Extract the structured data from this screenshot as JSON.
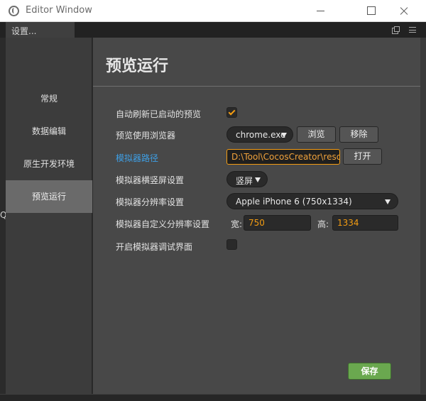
{
  "window": {
    "title": "Editor Window"
  },
  "panel": {
    "tab_label": "设置..."
  },
  "background": {
    "left_mark": "Q"
  },
  "sidebar": {
    "items": [
      {
        "label": "常规",
        "active": false
      },
      {
        "label": "数据编辑",
        "active": false
      },
      {
        "label": "原生开发环境",
        "active": false
      },
      {
        "label": "预览运行",
        "active": true
      }
    ]
  },
  "main": {
    "title": "预览运行",
    "auto_refresh": {
      "label": "自动刷新已启动的预览",
      "checked": true
    },
    "browser": {
      "label": "预览使用浏览器",
      "value": "chrome.exe",
      "browse_label": "浏览",
      "remove_label": "移除"
    },
    "simulator_path": {
      "label": "模拟器路径",
      "value": "D:\\Tool\\CocosCreator\\resou",
      "open_label": "打开"
    },
    "orientation": {
      "label": "模拟器横竖屏设置",
      "value": "竖屏"
    },
    "resolution": {
      "label": "模拟器分辨率设置",
      "value": "Apple iPhone 6 (750x1334)"
    },
    "custom_resolution": {
      "label": "模拟器自定义分辨率设置",
      "width_label": "宽:",
      "width_value": "750",
      "height_label": "高:",
      "height_value": "1334"
    },
    "debug_ui": {
      "label": "开启模拟器调试界面",
      "checked": false
    },
    "save_label": "保存"
  },
  "colors": {
    "accent": "#f39c12",
    "link": "#3e9fe5",
    "save": "#6aa84f"
  }
}
